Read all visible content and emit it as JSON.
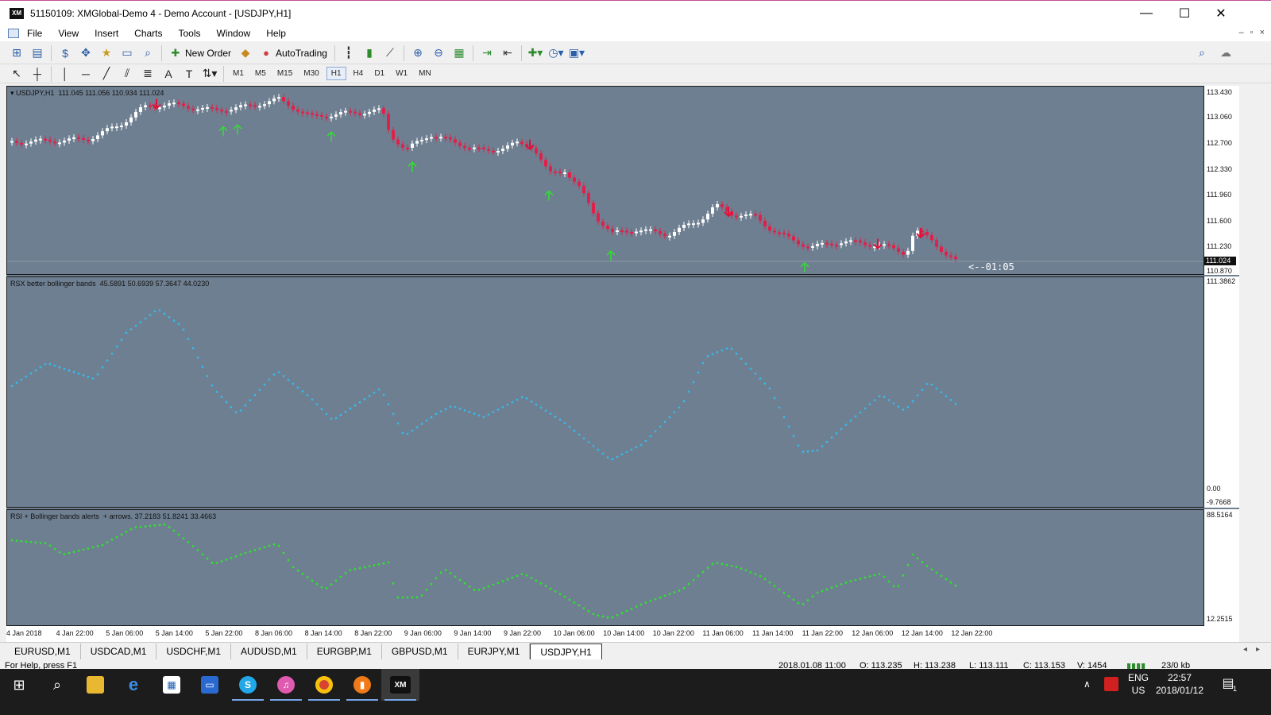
{
  "window": {
    "title": "51150109: XMGlobal-Demo 4 - Demo Account - [USDJPY,H1]",
    "logo": "XM",
    "minimize_label": "—",
    "maximize_label": "☐",
    "close_label": "✕"
  },
  "menu": {
    "items": [
      "File",
      "View",
      "Insert",
      "Charts",
      "Tools",
      "Window",
      "Help"
    ],
    "mdi_controls": [
      "–",
      "▫",
      "×"
    ]
  },
  "toolbar": {
    "new_order_label": "New Order",
    "autotrading_label": "AutoTrading"
  },
  "timeframes": {
    "items": [
      "M1",
      "M5",
      "M15",
      "M30",
      "H1",
      "H4",
      "D1",
      "W1",
      "MN"
    ],
    "active": "H1"
  },
  "price_pane": {
    "label": "USDJPY,H1  111.045 111.056 110.934 111.024",
    "axis_labels": [
      "113.430",
      "113.060",
      "112.700",
      "112.330",
      "111.960",
      "111.600",
      "111.230",
      "110.870"
    ],
    "current_price": "111.024",
    "countdown": "<--01:05"
  },
  "rsx_pane": {
    "label": "RSX better bollinger bands  45.5891 50.6939 57.3647 44.0230",
    "axis_labels": [
      "111.3862",
      "0.00",
      "-9.7668"
    ],
    "dot_color": "#38b8e8"
  },
  "rsi_pane": {
    "label": "RSI + Bollinger bands alerts  + arrows. 37.2183 51.8241 33.4663",
    "axis_labels": [
      "88.5164",
      "12.2515"
    ],
    "dot_color": "#30e030"
  },
  "time_axis": [
    "4 Jan 2018",
    "4 Jan 22:00",
    "5 Jan 06:00",
    "5 Jan 14:00",
    "5 Jan 22:00",
    "8 Jan 06:00",
    "8 Jan 14:00",
    "8 Jan 22:00",
    "9 Jan 06:00",
    "9 Jan 14:00",
    "9 Jan 22:00",
    "10 Jan 06:00",
    "10 Jan 14:00",
    "10 Jan 22:00",
    "11 Jan 06:00",
    "11 Jan 14:00",
    "11 Jan 22:00",
    "12 Jan 06:00",
    "12 Jan 14:00",
    "12 Jan 22:00"
  ],
  "tabs": {
    "items": [
      "EURUSD,M1",
      "USDCAD,M1",
      "USDCHF,M1",
      "AUDUSD,M1",
      "EURGBP,M1",
      "GBPUSD,M1",
      "EURJPY,M1",
      "USDJPY,H1"
    ],
    "active": "USDJPY,H1"
  },
  "status": {
    "help": "For Help, press F1",
    "datetime": "2018.01.08 11:00",
    "open": "O: 113.235",
    "high": "H: 113.238",
    "low": "L: 113.111",
    "close": "C: 113.153",
    "volume": "V: 1454",
    "traffic": "23/0 kb"
  },
  "taskbar": {
    "lang": "ENG",
    "region": "US",
    "time": "22:57",
    "date": "2018/01/12",
    "notifications": "1",
    "xm_label": "XM"
  },
  "colors": {
    "chart_bg": "#6e7f91",
    "bull": "#ffffff",
    "bear": "#e0204a",
    "arrow_up": "#30e030",
    "arrow_down": "#e0103a"
  }
}
